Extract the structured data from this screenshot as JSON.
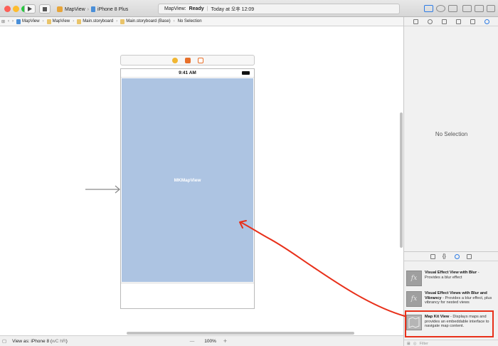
{
  "toolbar": {
    "scheme_target": "MapView",
    "scheme_device": "iPhone 8 Plus",
    "status_prefix": "MapView:",
    "status_state": "Ready",
    "status_sep": "|",
    "status_time": "Today at 오후 12:09"
  },
  "jumpbar": {
    "crumbs": [
      "MapView",
      "MapView",
      "Main.storyboard",
      "Main.storyboard (Base)",
      "No Selection"
    ]
  },
  "canvas": {
    "device_time": "9:41 AM",
    "map_label": "MKMapView"
  },
  "inspector": {
    "empty_text": "No Selection"
  },
  "library": {
    "items": [
      {
        "title": "Visual Effect View with Blur",
        "desc": " - Provides a blur effect"
      },
      {
        "title": "Visual Effect Views with Blur and Vibrancy",
        "desc": " - Provides a blur effect, plus vibrancy for nested views"
      },
      {
        "title": "Map Kit View",
        "desc": " - Displays maps and provides an embeddable interface to navigate map content."
      }
    ],
    "thumb_glyph": "fx",
    "filter_placeholder": "Filter"
  },
  "bottombar": {
    "view_as": "View as: iPhone 8 (",
    "view_as_shortcut": "wC hR",
    "view_as_close": ")",
    "zoom_minus": "—",
    "zoom_level": "100%",
    "zoom_plus": "+"
  },
  "colors": {
    "map_fill": "#adc4e2",
    "annotation_red": "#e8301a",
    "accent_blue": "#2c7be5"
  }
}
